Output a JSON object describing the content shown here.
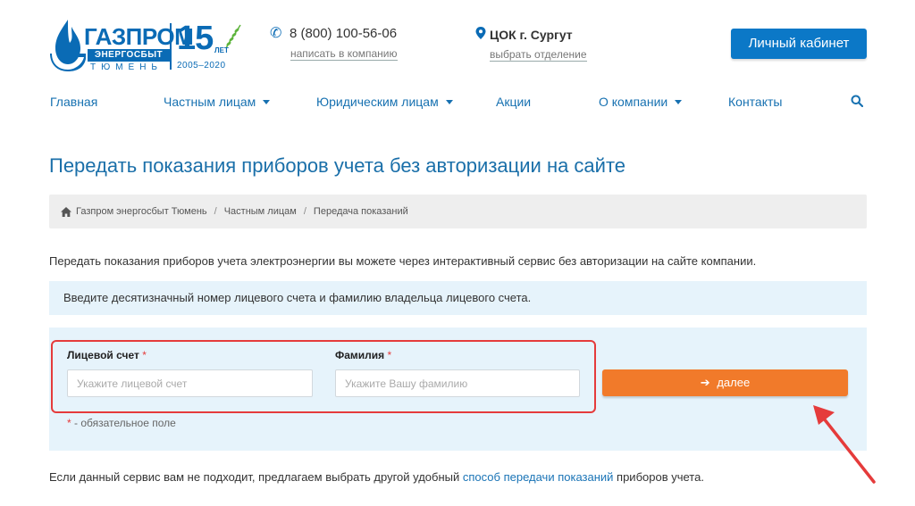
{
  "header": {
    "logo": {
      "word": "ГАЗПРОМ",
      "sub": "ЭНЕРГОСБЫТ",
      "city": "ТЮМЕНЬ",
      "anniversary": "15",
      "let": "ЛЕТ",
      "years": "2005–2020"
    },
    "phone": "8 (800) 100-56-06",
    "write_link": "написать в компанию",
    "office": "ЦОК г. Сургут",
    "choose_office": "выбрать отделение",
    "cabinet_button": "Личный кабинет"
  },
  "nav": {
    "items": [
      {
        "label": "Главная"
      },
      {
        "label": "Частным лицам"
      },
      {
        "label": "Юридическим лицам"
      },
      {
        "label": "Акции"
      },
      {
        "label": "О компании"
      },
      {
        "label": "Контакты"
      }
    ]
  },
  "page": {
    "title": "Передать показания приборов учета без авторизации на сайте",
    "breadcrumb": [
      "Газпром энергосбыт Тюмень",
      "Частным лицам",
      "Передача показаний"
    ],
    "breadcrumb_sep": "/",
    "intro": "Передать показания приборов учета электроэнергии вы можете через интерактивный сервис без авторизации на сайте компании.",
    "info": "Введите десятизначный номер лицевого счета и фамилию владельца лицевого счета."
  },
  "form": {
    "account_label": "Лицевой счет",
    "account_placeholder": "Укажите лицевой счет",
    "surname_label": "Фамилия",
    "surname_placeholder": "Укажите Вашу фамилию",
    "required_mark": "*",
    "next_button": "далее",
    "required_note": "- обязательное поле"
  },
  "footer_text": {
    "before": "Если данный сервис вам не подходит, предлагаем выбрать другой удобный ",
    "link": "способ передачи показаний",
    "after": " приборов учета."
  },
  "colors": {
    "brand_blue": "#0a6bb5",
    "accent_orange": "#f17a2a",
    "highlight_red": "#e53b3b",
    "info_bg": "#e6f3fb"
  }
}
